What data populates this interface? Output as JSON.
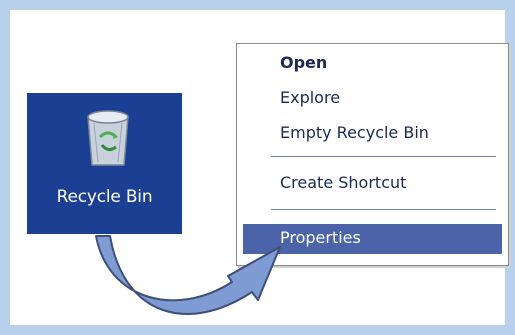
{
  "desktop": {
    "icon": "recycle-bin-icon",
    "label": "Recycle Bin"
  },
  "context_menu": {
    "items": [
      {
        "label": "Open",
        "bold": true
      },
      {
        "label": "Explore"
      },
      {
        "label": "Empty Recycle Bin"
      },
      {
        "label": "Create Shortcut"
      },
      {
        "label": "Properties",
        "highlighted": true
      }
    ]
  },
  "colors": {
    "tile": "#1b3f93",
    "highlight": "#4b63a8",
    "frame": "#b9d0ec"
  }
}
